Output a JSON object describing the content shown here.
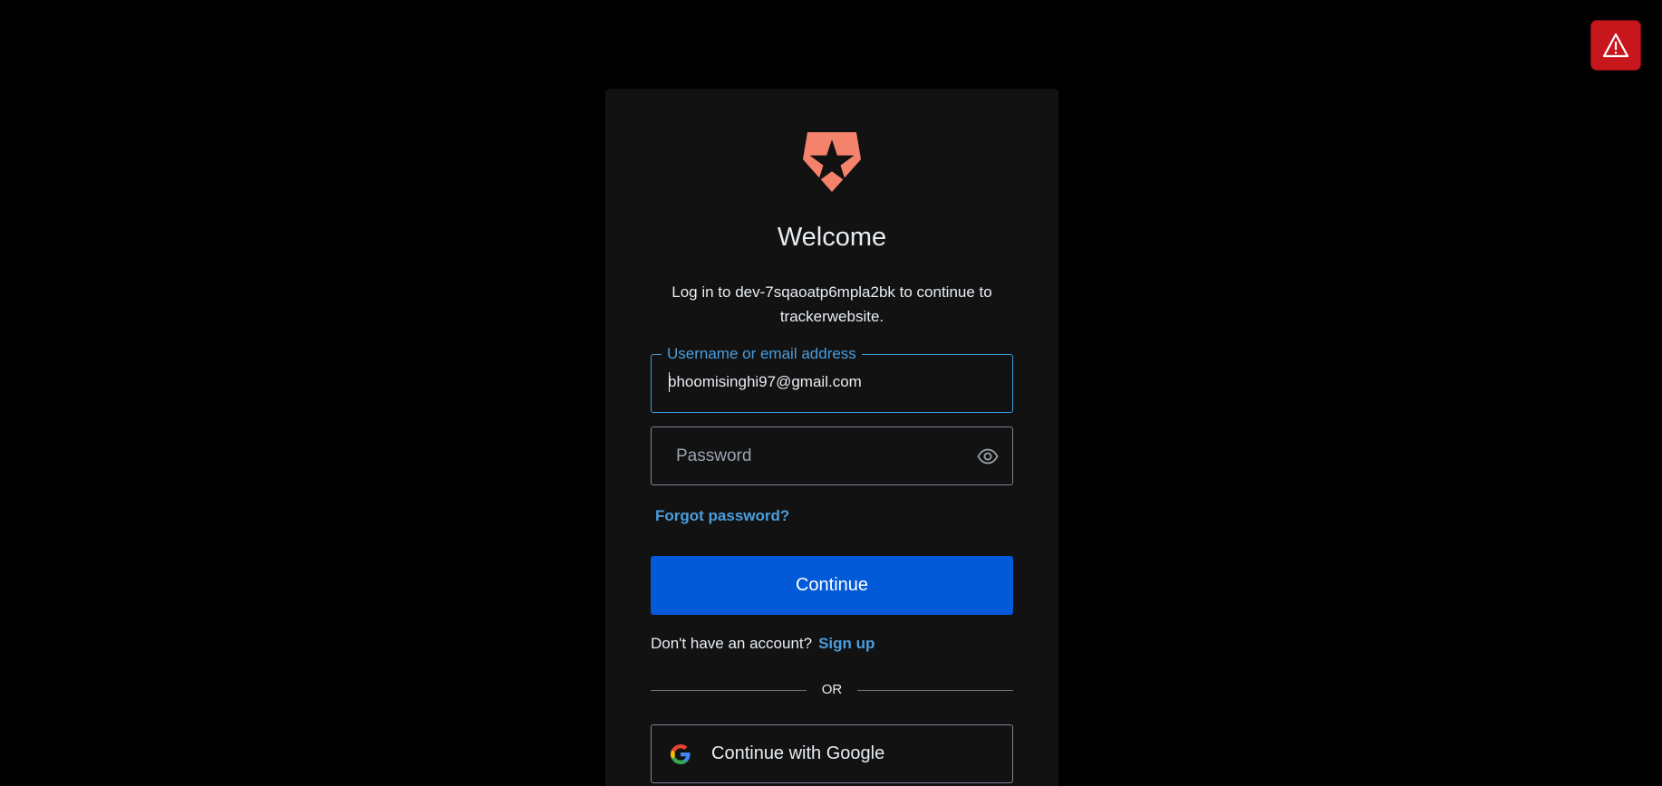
{
  "alert": {
    "icon": "warning-icon"
  },
  "card": {
    "logo_icon": "auth0-shield-logo-icon",
    "title": "Welcome",
    "subtitle": "Log in to dev-7sqaoatp6mpla2bk to continue to trackerwebsite."
  },
  "username": {
    "label": "Username or email address",
    "value": "bhoomisinghi97@gmail.com"
  },
  "password": {
    "placeholder": "Password",
    "value": "",
    "toggle_icon": "eye-icon"
  },
  "links": {
    "forgot_password": "Forgot password?"
  },
  "buttons": {
    "continue": "Continue",
    "google": "Continue with Google",
    "google_icon": "google-icon"
  },
  "signup": {
    "prompt": "Don't have an account?",
    "link": "Sign up"
  },
  "divider": {
    "text": "OR"
  },
  "colors": {
    "background": "#000000",
    "card": "#121212",
    "primary": "#025ad8",
    "link": "#4a9ede",
    "logo": "#f5836b",
    "alert": "#c8161d"
  }
}
